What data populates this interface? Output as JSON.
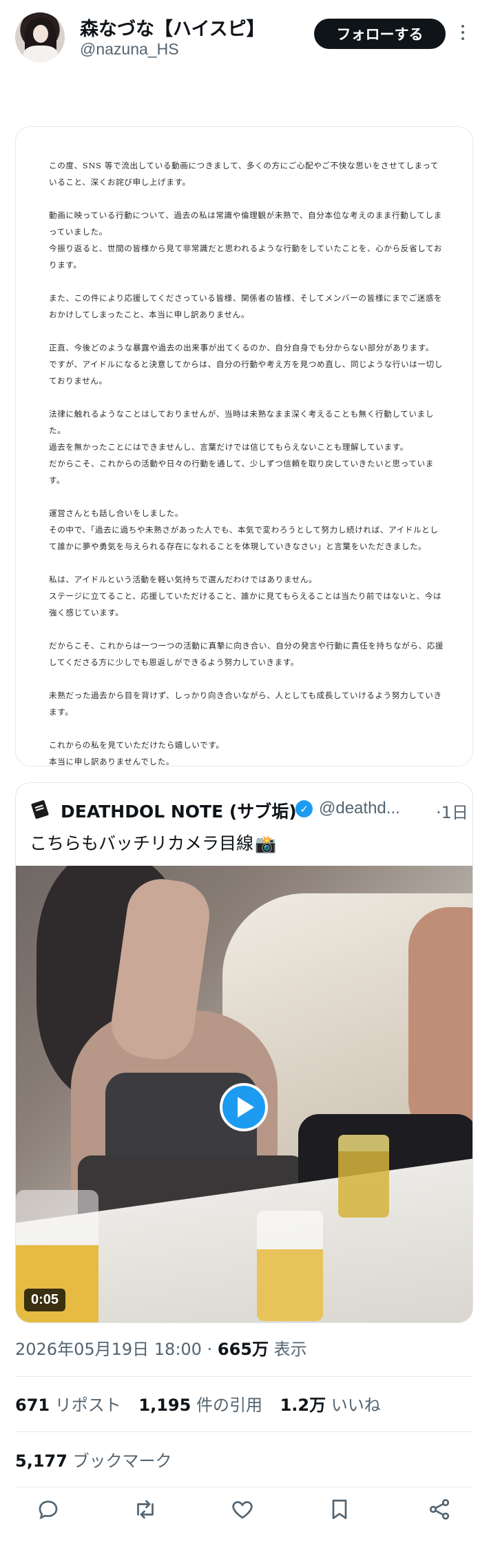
{
  "author": {
    "display_name": "森なづな【ハイスピ】",
    "handle": "@nazuna_HS",
    "avatar_icon": "profile-photo",
    "follow_label": "フォローする"
  },
  "statement": {
    "paragraphs": [
      "この度、SNS 等で流出している動画につきまして、多くの方にご心配やご不快な思いをさせてしまっていること、深くお詫び申し上げます。",
      "動画に映っている行動について、過去の私は常識や倫理観が未熟で、自分本位な考えのまま行動してしまっていました。\n今振り返ると、世間の皆様から見て非常識だと思われるような行動をしていたことを、心から反省しております。",
      "また、この件により応援してくださっている皆様、関係者の皆様、そしてメンバーの皆様にまでご迷惑をおかけしてしまったこと、本当に申し訳ありません。",
      "正直、今後どのような暴露や過去の出来事が出てくるのか、自分自身でも分からない部分があります。\nですが、アイドルになると決意してからは、自分の行動や考え方を見つめ直し、同じような行いは一切しておりません。",
      "法律に触れるようなことはしておりませんが、当時は未熟なまま深く考えることも無く行動していました。\n過去を無かったことにはできませんし、言葉だけでは信じてもらえないことも理解しています。\nだからこそ、これからの活動や日々の行動を通して、少しずつ信頼を取り戻していきたいと思っています。",
      "運営さんとも話し合いをしました。\nその中で、「過去に過ちや未熟さがあった人でも、本気で変わろうとして努力し続ければ、アイドルとして誰かに夢や勇気を与えられる存在になれることを体現していきなさい」と言葉をいただきました。",
      "私は、アイドルという活動を軽い気持ちで選んだわけではありません。\nステージに立てること、応援していただけること、誰かに見てもらえることは当たり前ではないと、今は強く感じています。",
      "だからこそ、これからは一つ一つの活動に真摯に向き合い、自分の発言や行動に責任を持ちながら、応援してくださる方に少しでも恩返しができるよう努力していきます。",
      "未熟だった過去から目を背けず、しっかり向き合いながら、人としても成長していけるよう努力していきます。",
      "これからの私を見ていただけたら嬉しいです。\n本当に申し訳ありませんでした。"
    ]
  },
  "quoted_post": {
    "author_name": "DEATHDOL NOTE (サブ垢)",
    "author_handle": "@deathd...",
    "time_ago": "·1日",
    "text": "こちらもバッチリカメラ目線",
    "emoji": "📸",
    "video_duration": "0:05",
    "play_icon": "play-icon",
    "verified_icon": "verified-badge-icon"
  },
  "meta": {
    "date": "2026年05月19日 18:00",
    "separator": "·",
    "views_count": "665万",
    "views_label": "表示"
  },
  "stats": {
    "reposts_count": "671",
    "reposts_label": "リポスト",
    "quotes_count": "1,195",
    "quotes_label": "件の引用",
    "likes_count": "1.2万",
    "likes_label": "いいね",
    "bookmarks_count": "5,177",
    "bookmarks_label": "ブックマーク"
  },
  "actions": {
    "icons": [
      "reply-icon",
      "repost-icon",
      "like-icon",
      "bookmark-icon",
      "share-icon"
    ],
    "color": "#536471"
  },
  "colors": {
    "accent": "#1d9bf0",
    "text": "#0f1419",
    "secondary": "#536471"
  }
}
